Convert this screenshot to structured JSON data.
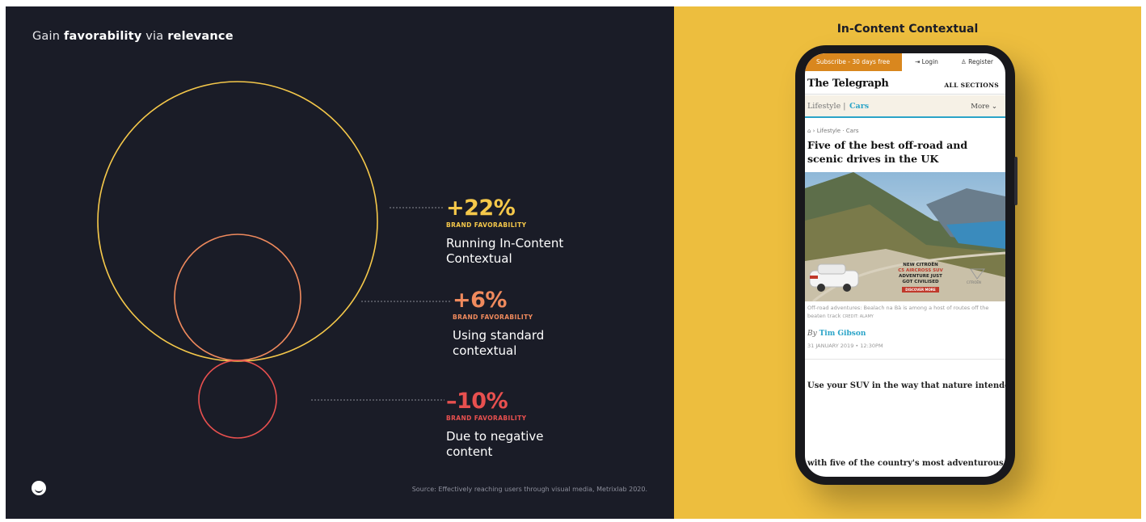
{
  "left_panel": {
    "heading": {
      "prefix": "Gain ",
      "bold1": "favorability",
      "middle": " via ",
      "bold2": "relevance"
    },
    "colors": {
      "background": "#1a1c27",
      "yellow": "#f5c84a",
      "orange": "#f08a5d",
      "red": "#e8504f"
    },
    "stats": [
      {
        "percent": "+22%",
        "label": "BRAND FAVORABILITY",
        "desc_line1": "Running In-Content",
        "desc_line2": "Contextual",
        "color": "#f5c84a"
      },
      {
        "percent": "+6%",
        "label": "BRAND FAVORABILITY",
        "desc_line1": "Using standard",
        "desc_line2": "contextual",
        "color": "#f08a5d"
      },
      {
        "percent": "–10%",
        "label": "BRAND FAVORABILITY",
        "desc_line1": "Due to negative",
        "desc_line2": "content",
        "color": "#e8504f"
      }
    ],
    "logo_icon": "smile-logo-icon",
    "source": "Source: Effectively reaching users through visual media, Metrixlab 2020."
  },
  "right_panel": {
    "title": "In-Content Contextual",
    "background": "#edbe3e",
    "phone": {
      "topbar": {
        "subscribe": "Subscribe - 30 days free",
        "login": "Login",
        "register": "Register"
      },
      "brand": "The Telegraph",
      "all_sections": "ALL SECTIONS",
      "section": "Lifestyle",
      "subsection": "Cars",
      "more": "More",
      "breadcrumb": "Lifestyle · Cars",
      "headline": "Five of the best off-road and scenic drives in the UK",
      "ad": {
        "line1": "NEW CITROËN",
        "line2": "C5 AIRCROSS SUV",
        "line3": "ADVENTURE JUST",
        "line4": "GOT CIVILISED",
        "cta": "DISCOVER MORE",
        "brand": "CITROËN"
      },
      "caption": "Off-road adventures: Bealach na Bà is among a host of routes off the beaten track",
      "caption_credit": "CREDIT: ALAMY",
      "byline_prefix": "By",
      "author": "Tim Gibson",
      "date": "31 JANUARY 2019 • 12:30PM",
      "body_line1": "Use your SUV in the way that nature intended,",
      "body_line2": "with five of the country's most adventurous"
    }
  }
}
